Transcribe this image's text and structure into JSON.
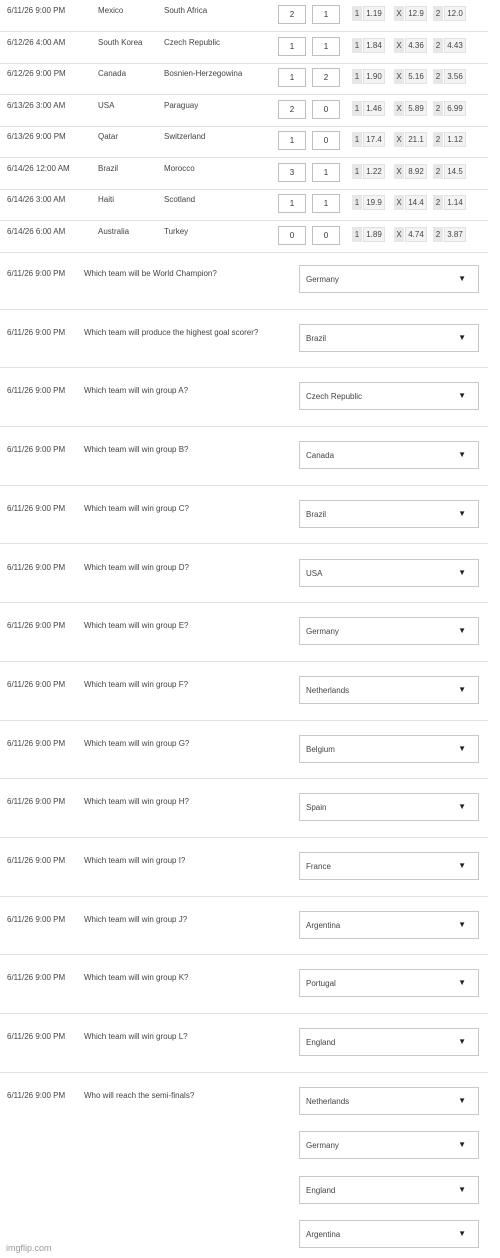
{
  "matches": [
    {
      "date": "6/11/26 9:00 PM",
      "home": "Mexico",
      "away": "South Africa",
      "home_score": "2",
      "away_score": "1",
      "odds": {
        "one_label": "1",
        "one": "1.19",
        "x_label": "X",
        "x": "12.9",
        "two_label": "2",
        "two": "12.0"
      }
    },
    {
      "date": "6/12/26 4:00 AM",
      "home": "South Korea",
      "away": "Czech Republic",
      "home_score": "1",
      "away_score": "1",
      "odds": {
        "one_label": "1",
        "one": "1.84",
        "x_label": "X",
        "x": "4.36",
        "two_label": "2",
        "two": "4.43"
      }
    },
    {
      "date": "6/12/26 9:00 PM",
      "home": "Canada",
      "away": "Bosnien-Herzegowina",
      "home_score": "1",
      "away_score": "2",
      "odds": {
        "one_label": "1",
        "one": "1.90",
        "x_label": "X",
        "x": "5.16",
        "two_label": "2",
        "two": "3.56"
      }
    },
    {
      "date": "6/13/26 3:00 AM",
      "home": "USA",
      "away": "Paraguay",
      "home_score": "2",
      "away_score": "0",
      "odds": {
        "one_label": "1",
        "one": "1.46",
        "x_label": "X",
        "x": "5.89",
        "two_label": "2",
        "two": "6.99"
      }
    },
    {
      "date": "6/13/26 9:00 PM",
      "home": "Qatar",
      "away": "Switzerland",
      "home_score": "1",
      "away_score": "0",
      "odds": {
        "one_label": "1",
        "one": "17.4",
        "x_label": "X",
        "x": "21.1",
        "two_label": "2",
        "two": "1.12"
      }
    },
    {
      "date": "6/14/26 12:00 AM",
      "home": "Brazil",
      "away": "Morocco",
      "home_score": "3",
      "away_score": "1",
      "odds": {
        "one_label": "1",
        "one": "1.22",
        "x_label": "X",
        "x": "8.92",
        "two_label": "2",
        "two": "14.5"
      }
    },
    {
      "date": "6/14/26 3:00 AM",
      "home": "Haiti",
      "away": "Scotland",
      "home_score": "1",
      "away_score": "1",
      "odds": {
        "one_label": "1",
        "one": "19.9",
        "x_label": "X",
        "x": "14.4",
        "two_label": "2",
        "two": "1.14"
      }
    },
    {
      "date": "6/14/26 6:00 AM",
      "home": "Australia",
      "away": "Turkey",
      "home_score": "0",
      "away_score": "0",
      "odds": {
        "one_label": "1",
        "one": "1.89",
        "x_label": "X",
        "x": "4.74",
        "two_label": "2",
        "two": "3.87"
      }
    }
  ],
  "questions": [
    {
      "date": "6/11/26 9:00 PM",
      "text": "Which team will be World Champion?",
      "answers": [
        "Germany"
      ]
    },
    {
      "date": "6/11/26 9:00 PM",
      "text": "Which team will produce the highest goal scorer?",
      "answers": [
        "Brazil"
      ]
    },
    {
      "date": "6/11/26 9:00 PM",
      "text": "Which team will win group A?",
      "answers": [
        "Czech Republic"
      ]
    },
    {
      "date": "6/11/26 9:00 PM",
      "text": "Which team will win group B?",
      "answers": [
        "Canada"
      ]
    },
    {
      "date": "6/11/26 9:00 PM",
      "text": "Which team will win group C?",
      "answers": [
        "Brazil"
      ]
    },
    {
      "date": "6/11/26 9:00 PM",
      "text": "Which team will win group D?",
      "answers": [
        "USA"
      ]
    },
    {
      "date": "6/11/26 9:00 PM",
      "text": "Which team will win group E?",
      "answers": [
        "Germany"
      ]
    },
    {
      "date": "6/11/26 9:00 PM",
      "text": "Which team will win group F?",
      "answers": [
        "Netherlands"
      ]
    },
    {
      "date": "6/11/26 9:00 PM",
      "text": "Which team will win group G?",
      "answers": [
        "Belgium"
      ]
    },
    {
      "date": "6/11/26 9:00 PM",
      "text": "Which team will win group H?",
      "answers": [
        "Spain"
      ]
    },
    {
      "date": "6/11/26 9:00 PM",
      "text": "Which team will win group I?",
      "answers": [
        "France"
      ]
    },
    {
      "date": "6/11/26 9:00 PM",
      "text": "Which team will win group J?",
      "answers": [
        "Argentina"
      ]
    },
    {
      "date": "6/11/26 9:00 PM",
      "text": "Which team will win group K?",
      "answers": [
        "Portugal"
      ]
    },
    {
      "date": "6/11/26 9:00 PM",
      "text": "Which team will win group L?",
      "answers": [
        "England"
      ]
    },
    {
      "date": "6/11/26 9:00 PM",
      "text": "Who will reach the semi-finals?",
      "answers": [
        "Netherlands",
        "Germany",
        "England",
        "Argentina"
      ]
    }
  ],
  "dropdown_arrow": "▼",
  "watermark": "imgflip.com",
  "colors": {
    "divider": "#e2e2e2",
    "odd_label_bg": "#e7e7e7",
    "odd_value_bg": "#f3f3f3"
  }
}
